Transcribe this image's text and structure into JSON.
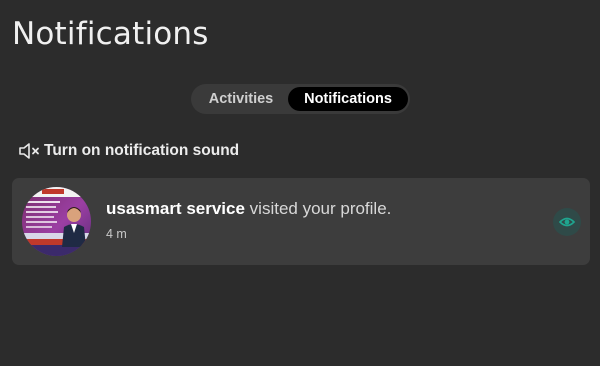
{
  "header": {
    "title": "Notifications"
  },
  "tabs": {
    "items": [
      {
        "label": "Activities",
        "active": false
      },
      {
        "label": "Notifications",
        "active": true
      }
    ]
  },
  "sound_toggle": {
    "icon": "speaker-muted-icon",
    "label": "Turn on notification sound"
  },
  "notifications": [
    {
      "avatar_icon": "profile-avatar",
      "user": "usasmart service",
      "message": " visited your profile.",
      "time": "4 m",
      "action_icon": "eye-icon"
    }
  ],
  "colors": {
    "background": "#2c2c2c",
    "card": "#3d3d3d",
    "active_tab": "#000000",
    "eye_accent": "#1fa58f"
  }
}
